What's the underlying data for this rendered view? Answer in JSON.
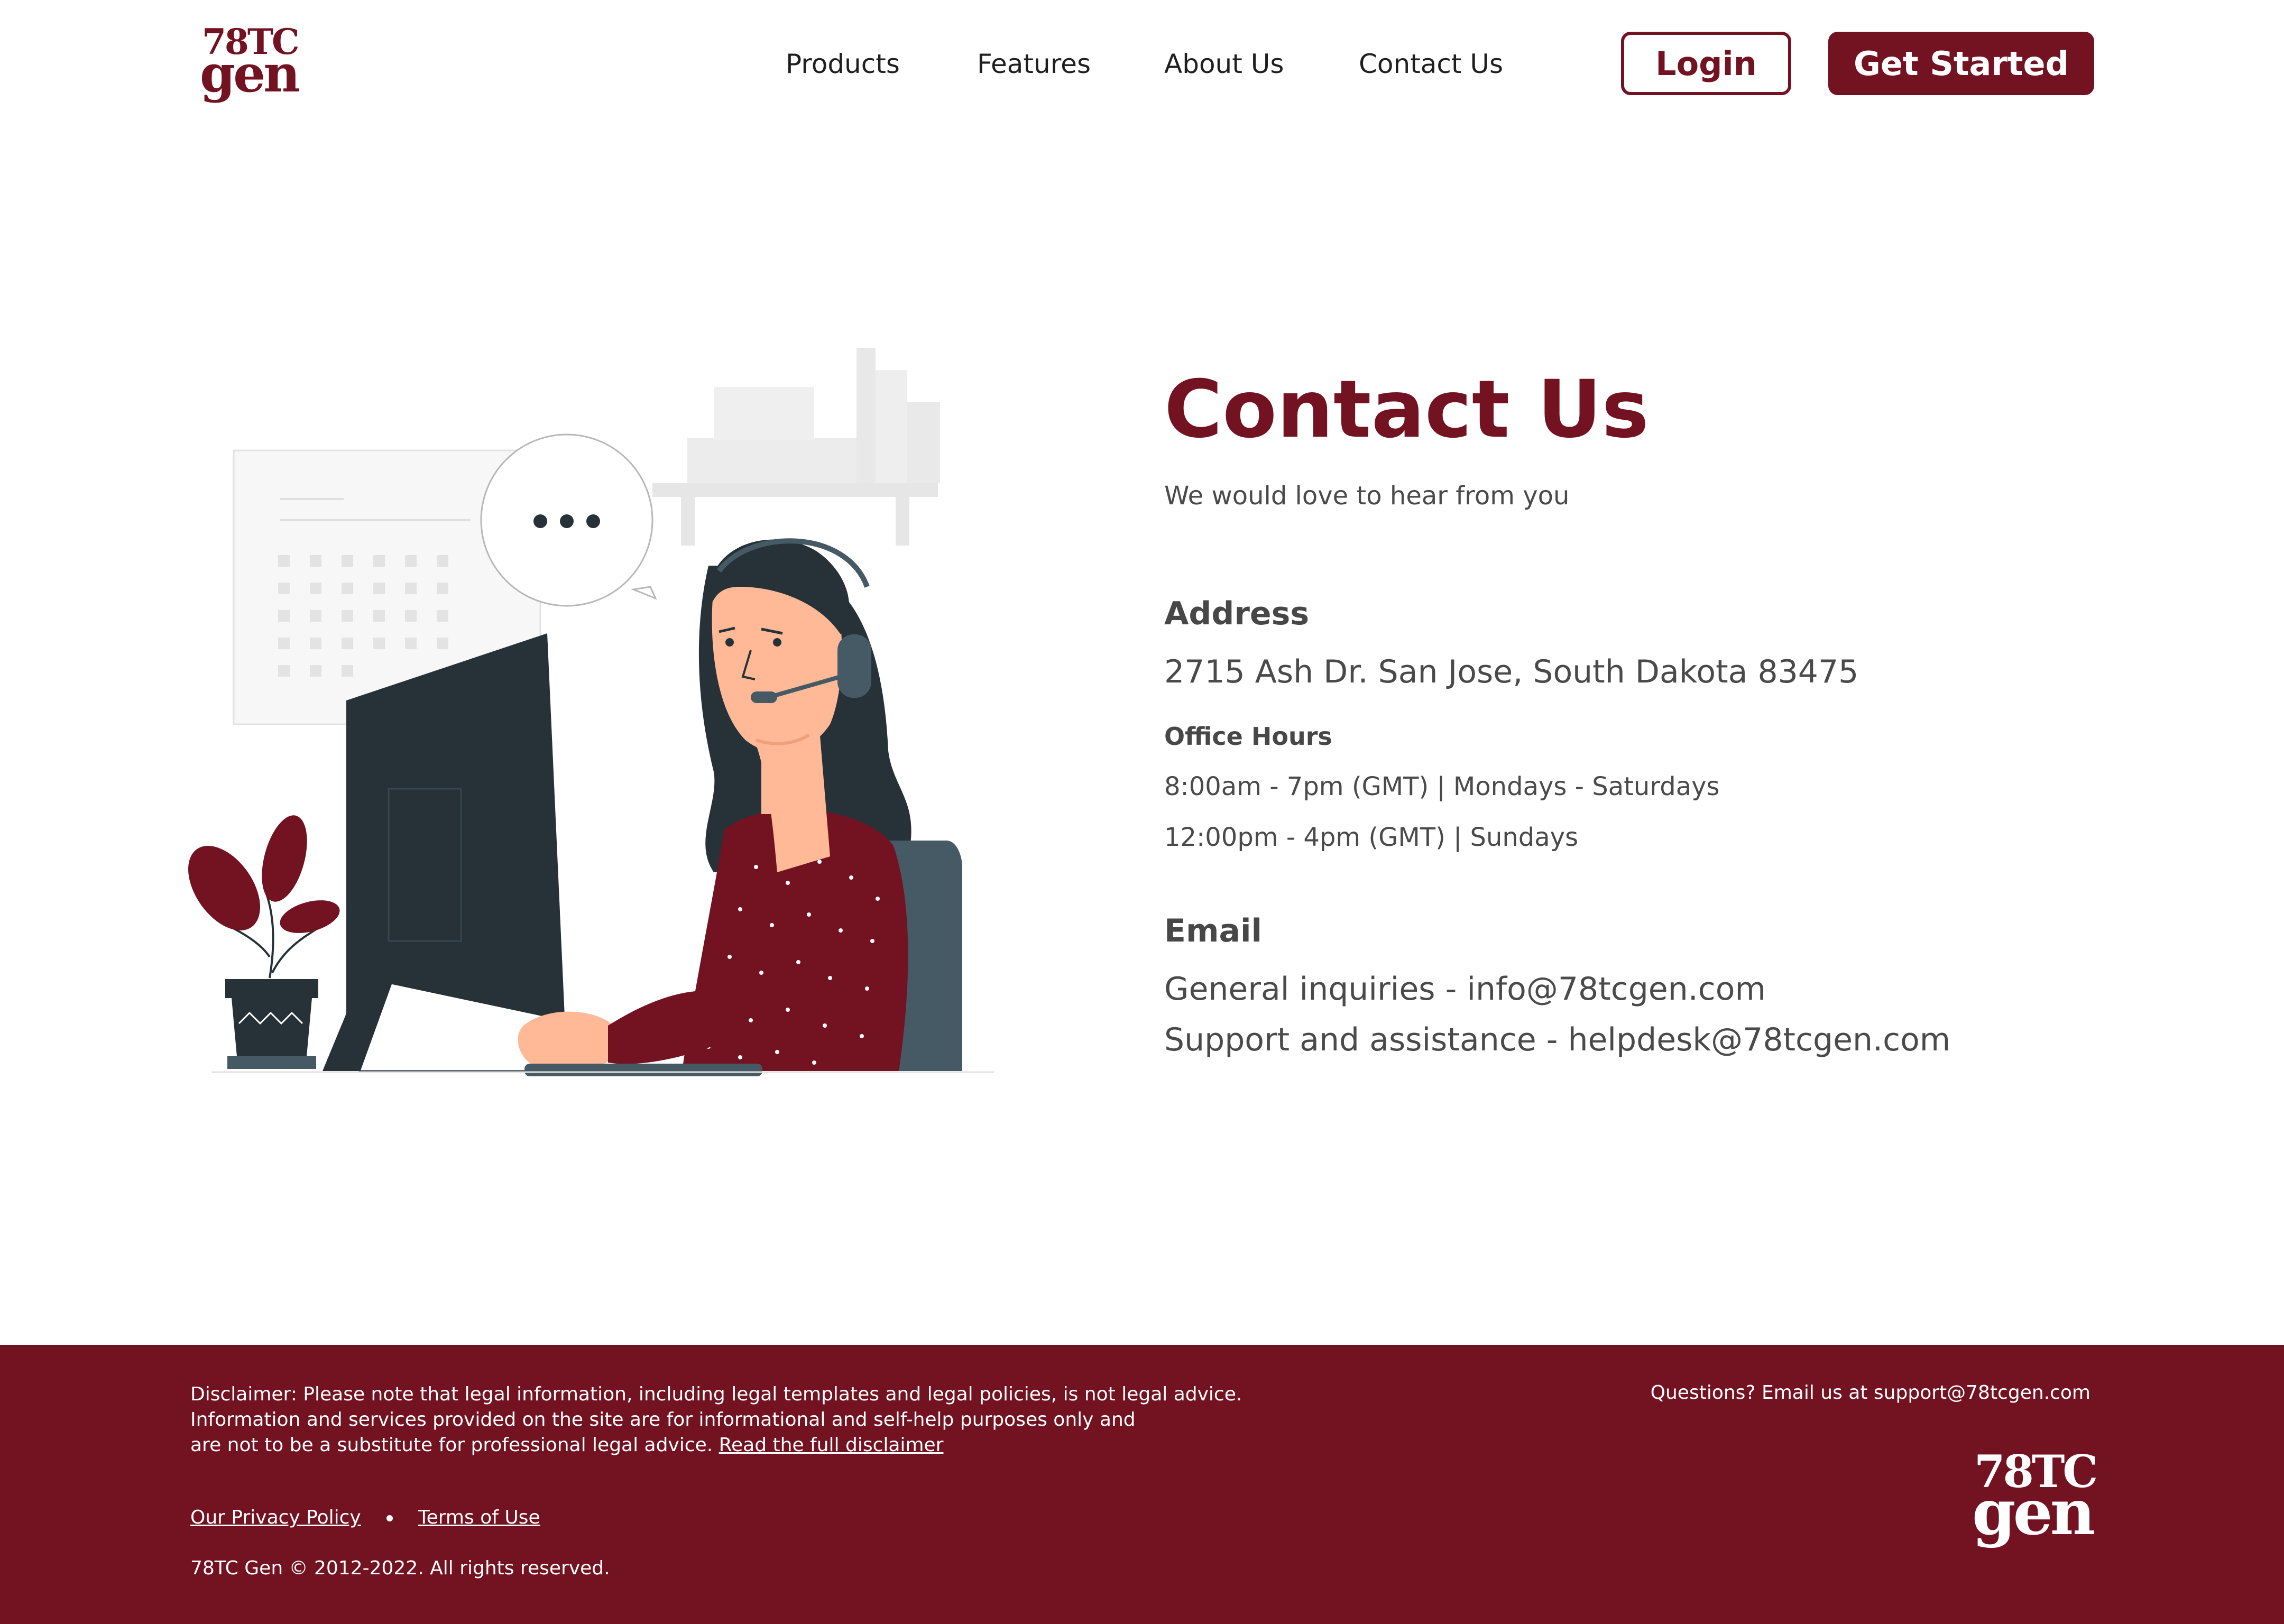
{
  "brand": {
    "logo_line1": "78TC",
    "logo_line2": "gen",
    "primary_color": "#731221"
  },
  "nav": {
    "items": [
      "Products",
      "Features",
      "About Us",
      "Contact Us"
    ],
    "login_label": "Login",
    "cta_label": "Get Started"
  },
  "contact": {
    "title": "Contact Us",
    "subtitle": "We would love to hear from you",
    "address_heading": "Address",
    "address": "2715 Ash Dr. San Jose, South Dakota 83475",
    "office_hours_heading": "Office Hours",
    "hours": [
      "8:00am - 7pm (GMT) | Mondays - Saturdays",
      "12:00pm - 4pm (GMT) | Sundays"
    ],
    "email_heading": "Email",
    "emails": [
      "General inquiries - info@78tcgen.com",
      "Support and assistance - helpdesk@78tcgen.com"
    ]
  },
  "illustration": {
    "icon": "customer-support-agent-illustration",
    "speech_bubble_icon": "ellipsis-icon"
  },
  "footer": {
    "disclaimer_lines": [
      "Disclaimer: Please note that legal information, including legal templates and legal policies, is not legal advice.",
      "Information and services provided on the site are for informational and self-help purposes only and",
      "are not to be a substitute for professional legal advice."
    ],
    "disclaimer_link": "Read the full disclaimer",
    "questions": "Questions? Email us at support@78tcgen.com",
    "privacy_link": "Our Privacy Policy",
    "terms_link": "Terms of Use",
    "copyright": "78TC Gen © 2012-2022. All rights reserved."
  }
}
